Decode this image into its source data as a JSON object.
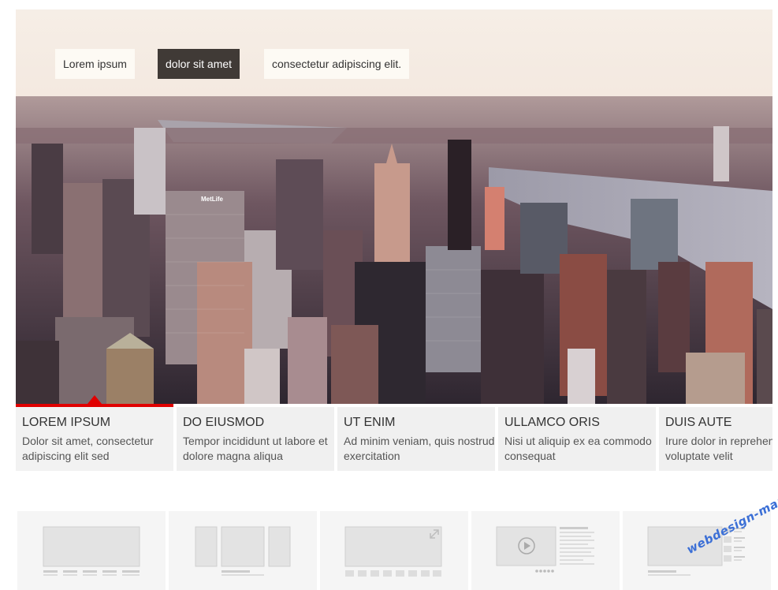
{
  "slider": {
    "captions": [
      "Lorem ipsum",
      "dolor sit amet",
      "consectetur adipiscing elit."
    ],
    "building_sign": "MetLife"
  },
  "tabs": [
    {
      "title": "LOREM IPSUM",
      "text": "Dolor sit amet, consectetur adipiscing elit sed",
      "active": true
    },
    {
      "title": "DO EIUSMOD",
      "text": "Tempor incididunt ut labore et dolore magna aliqua",
      "active": false
    },
    {
      "title": "UT ENIM",
      "text": "Ad minim veniam, quis nostrud exercitation",
      "active": false
    },
    {
      "title": "ULLAMCO ORIS",
      "text": "Nisi ut aliquip ex ea commodo consequat",
      "active": false
    },
    {
      "title": "DUIS AUTE",
      "text": "Irure dolor in reprehenderit in voluptate velit",
      "active": false
    }
  ],
  "layout_thumbnails": [
    {
      "icon": "single-slide-layout-icon"
    },
    {
      "icon": "three-panel-carousel-layout-icon"
    },
    {
      "icon": "fullscreen-thumbnails-layout-icon"
    },
    {
      "icon": "video-with-text-layout-icon"
    },
    {
      "icon": "slide-with-thumbnail-list-layout-icon"
    }
  ],
  "watermark": "webdesign-mania",
  "colors": {
    "accent": "#e00000",
    "caption_active_bg": "#403a36",
    "tab_bg": "#f0f0f0"
  }
}
